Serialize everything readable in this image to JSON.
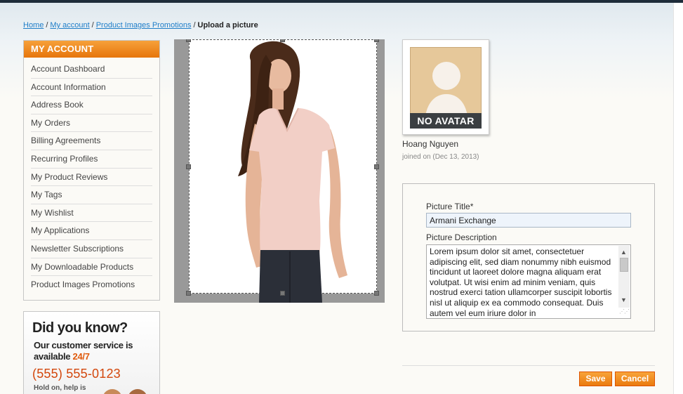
{
  "breadcrumb": {
    "home": "Home",
    "my_account": "My account",
    "promotions": "Product Images Promotions",
    "current": "Upload a picture",
    "separator": "/"
  },
  "sidebar": {
    "title": "MY ACCOUNT",
    "items": [
      {
        "label": "Account Dashboard"
      },
      {
        "label": "Account Information"
      },
      {
        "label": "Address Book"
      },
      {
        "label": "My Orders"
      },
      {
        "label": "Billing Agreements"
      },
      {
        "label": "Recurring Profiles"
      },
      {
        "label": "My Product Reviews"
      },
      {
        "label": "My Tags"
      },
      {
        "label": "My Wishlist"
      },
      {
        "label": "My Applications"
      },
      {
        "label": "Newsletter Subscriptions"
      },
      {
        "label": "My Downloadable Products"
      },
      {
        "label": "Product Images Promotions"
      }
    ]
  },
  "promo": {
    "title": "Did you know?",
    "line1": "Our customer service is",
    "line2_prefix": "available ",
    "line2_highlight": "24/7",
    "phone": "(555) 555-0123",
    "hold": "Hold on, help is"
  },
  "avatar": {
    "label": "NO AVATAR"
  },
  "user": {
    "name": "Hoang Nguyen",
    "joined": "joined on (Dec 13, 2013)"
  },
  "form": {
    "title_label": "Picture Title*",
    "title_value": "Armani Exchange",
    "description_label": "Picture Description",
    "description_value": "Lorem ipsum dolor sit amet, consectetuer adipiscing elit, sed diam nonummy nibh euismod tincidunt ut laoreet dolore magna aliquam erat volutpat. Ut wisi enim ad minim veniam, quis nostrud exerci tation ullamcorper suscipit lobortis nisl ut aliquip ex ea commodo consequat. Duis autem vel eum iriure dolor in"
  },
  "actions": {
    "save": "Save",
    "cancel": "Cancel"
  },
  "colors": {
    "accent": "#e6750c",
    "link": "#1e7ec8",
    "phone": "#d3460b"
  }
}
